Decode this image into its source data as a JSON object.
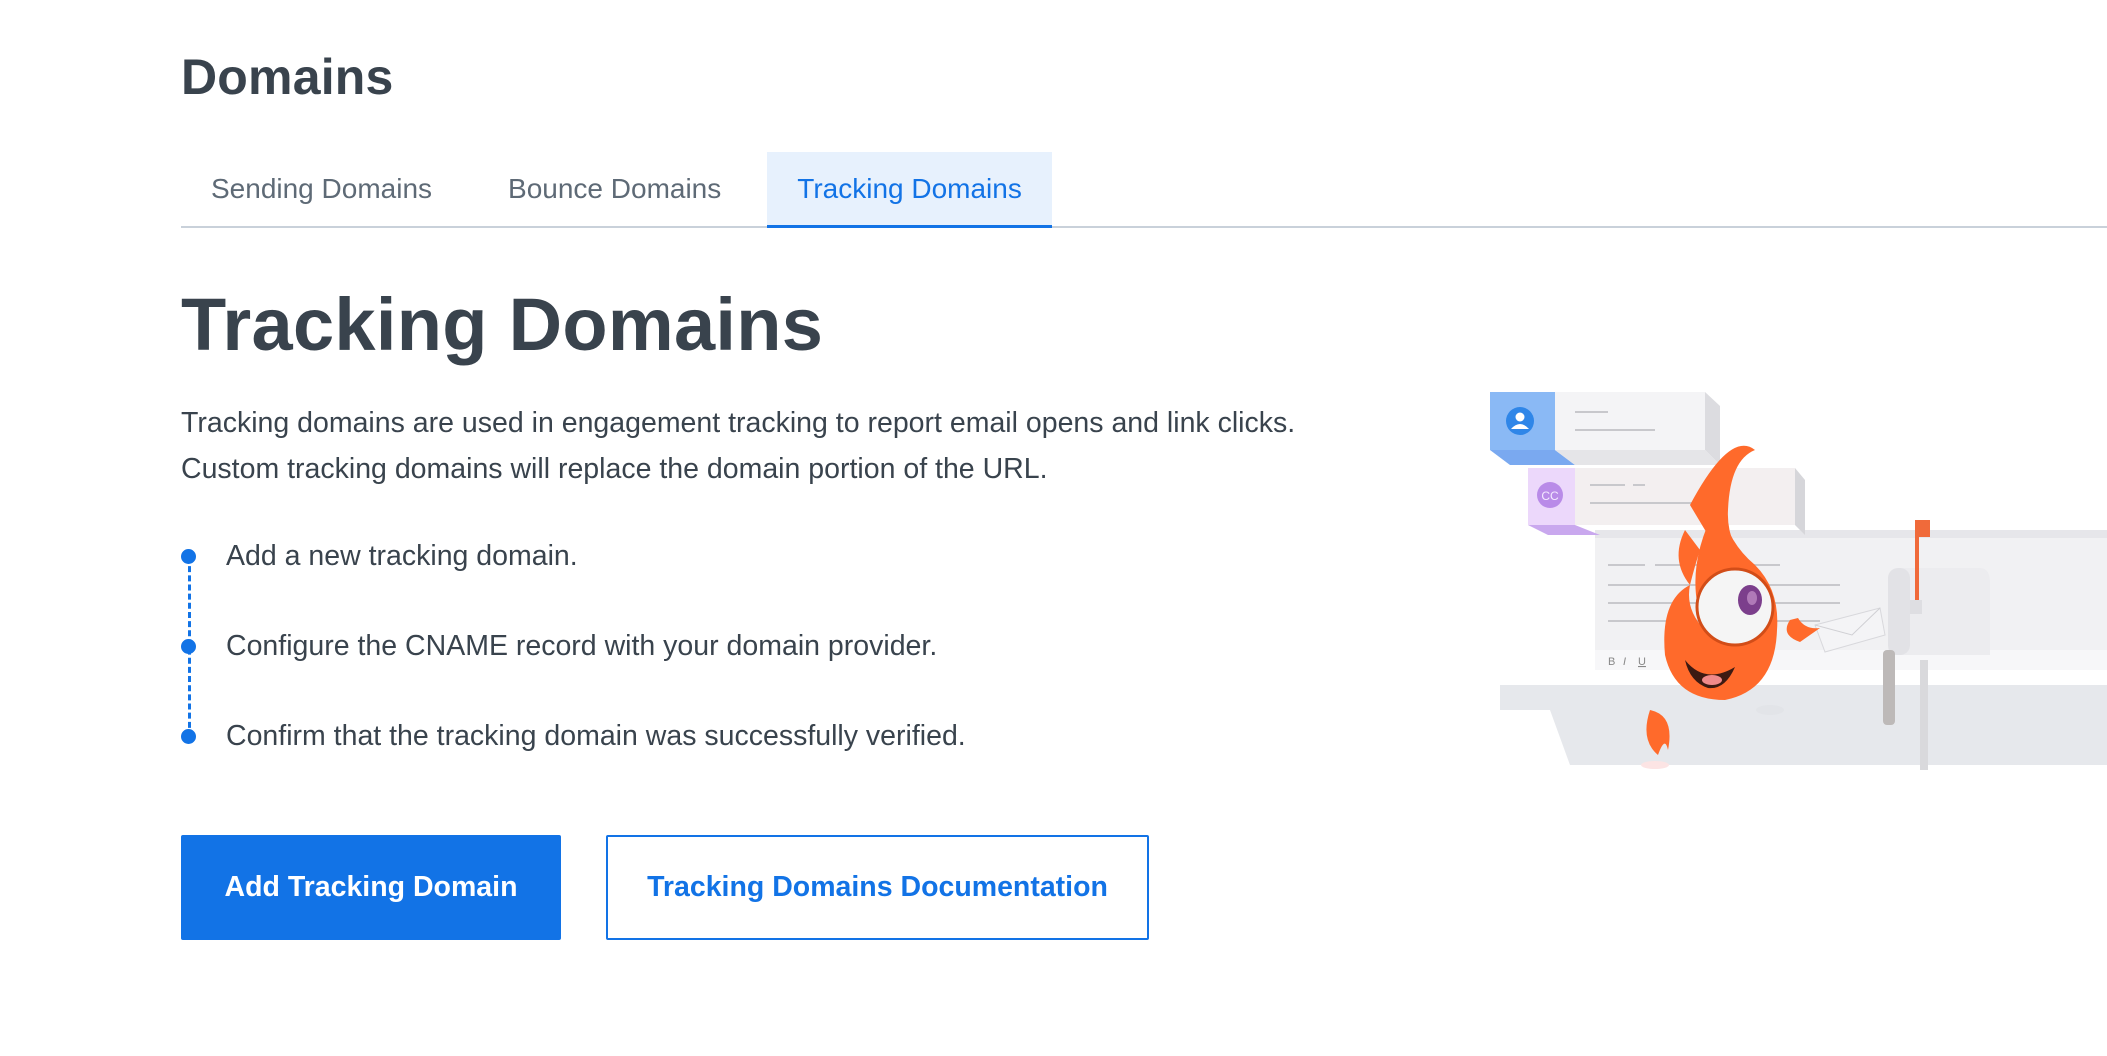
{
  "page": {
    "title": "Domains"
  },
  "tabs": [
    {
      "label": "Sending Domains",
      "active": false
    },
    {
      "label": "Bounce Domains",
      "active": false
    },
    {
      "label": "Tracking Domains",
      "active": true
    }
  ],
  "hero": {
    "title": "Tracking Domains",
    "description": "Tracking domains are used in engagement tracking to report email opens and link clicks. Custom tracking domains will replace the domain portion of the URL.",
    "steps": [
      "Add a new tracking domain.",
      "Configure the CNAME record with your domain provider.",
      "Confirm that the tracking domain was successfully verified."
    ],
    "primary_button": "Add Tracking Domain",
    "secondary_button": "Tracking Domains Documentation"
  },
  "illustration": {
    "description": "Orange flame mascot mailing a letter into a mailbox in front of an email compose window",
    "recipient_badge": "CC",
    "editor_toolbar": [
      "B",
      "I",
      "U"
    ]
  },
  "colors": {
    "accent": "#1273e6",
    "active_tab_bg": "#e7f1fd",
    "text": "#39434d",
    "tab_text": "#5e6a76",
    "divider": "#c9d1da",
    "mascot": "#ff6a2b"
  }
}
